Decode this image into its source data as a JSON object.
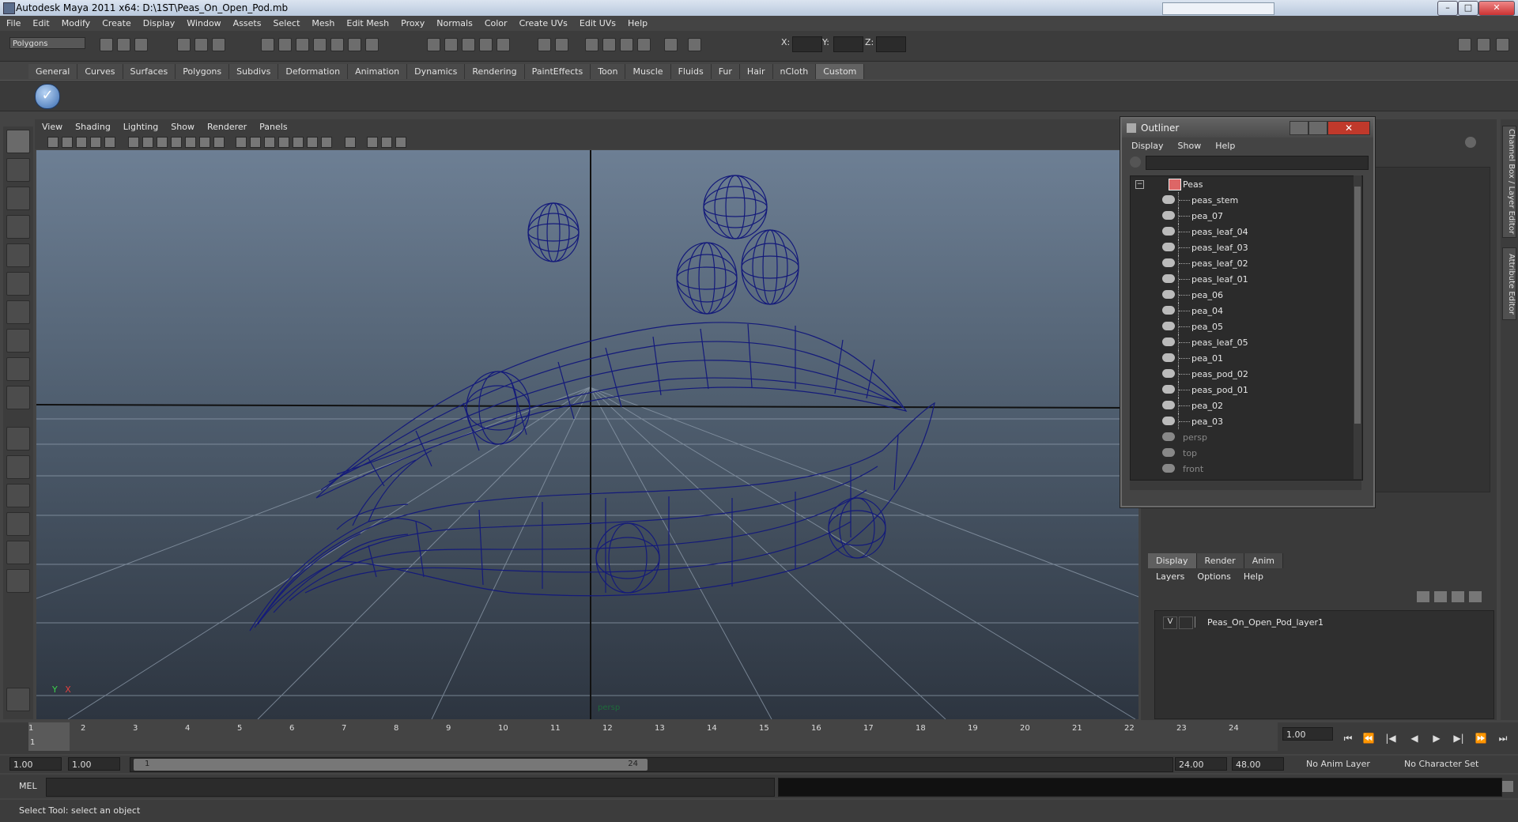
{
  "window": {
    "title": "Autodesk Maya 2011 x64: D:\\1ST\\Peas_On_Open_Pod.mb",
    "buttons": {
      "minimize": "–",
      "maximize": "□",
      "close": "✕"
    }
  },
  "menubar": [
    "File",
    "Edit",
    "Modify",
    "Create",
    "Display",
    "Window",
    "Assets",
    "Select",
    "Mesh",
    "Edit Mesh",
    "Proxy",
    "Normals",
    "Color",
    "Create UVs",
    "Edit UVs",
    "Help"
  ],
  "statusline": {
    "mode": "Polygons",
    "x_label": "X:",
    "y_label": "Y:",
    "z_label": "Z:"
  },
  "shelf_tabs": [
    "General",
    "Curves",
    "Surfaces",
    "Polygons",
    "Subdivs",
    "Deformation",
    "Animation",
    "Dynamics",
    "Rendering",
    "PaintEffects",
    "Toon",
    "Muscle",
    "Fluids",
    "Fur",
    "Hair",
    "nCloth",
    "Custom"
  ],
  "shelf_active": "Custom",
  "viewport": {
    "menu": [
      "View",
      "Shading",
      "Lighting",
      "Show",
      "Renderer",
      "Panels"
    ],
    "camera": "persp",
    "axis_y": "Y",
    "axis_x": "X",
    "wire_color": "#141a7a"
  },
  "outliner": {
    "title": "Outliner",
    "menu": [
      "Display",
      "Show",
      "Help"
    ],
    "root": "Peas",
    "children": [
      "peas_stem",
      "pea_07",
      "peas_leaf_04",
      "peas_leaf_03",
      "peas_leaf_02",
      "peas_leaf_01",
      "pea_06",
      "pea_04",
      "pea_05",
      "peas_leaf_05",
      "pea_01",
      "peas_pod_02",
      "peas_pod_01",
      "pea_02",
      "pea_03"
    ],
    "cameras": [
      "persp",
      "top",
      "front"
    ]
  },
  "side_tabs": [
    "Channel Box / Layer Editor",
    "Attribute Editor"
  ],
  "layer_editor": {
    "tabs": [
      "Display",
      "Render",
      "Anim"
    ],
    "active_tab": "Display",
    "menu": [
      "Layers",
      "Options",
      "Help"
    ],
    "layer": {
      "visibility": "V",
      "name": "Peas_On_Open_Pod_layer1"
    }
  },
  "timeline": {
    "ticks": [
      "1",
      "2",
      "3",
      "4",
      "5",
      "6",
      "7",
      "8",
      "9",
      "10",
      "11",
      "12",
      "13",
      "14",
      "15",
      "16",
      "17",
      "18",
      "19",
      "20",
      "21",
      "22",
      "23",
      "24"
    ],
    "current_frame_marker": "1",
    "current_time": "1.00"
  },
  "range": {
    "start_time": "1.00",
    "playback_start": "1.00",
    "range_start_label": "1",
    "range_end_label": "24",
    "playback_end": "24.00",
    "end_time": "48.00",
    "anim_layer": "No Anim Layer",
    "character_set": "No Character Set"
  },
  "command_line": {
    "label": "MEL"
  },
  "help_line": "Select Tool: select an object"
}
